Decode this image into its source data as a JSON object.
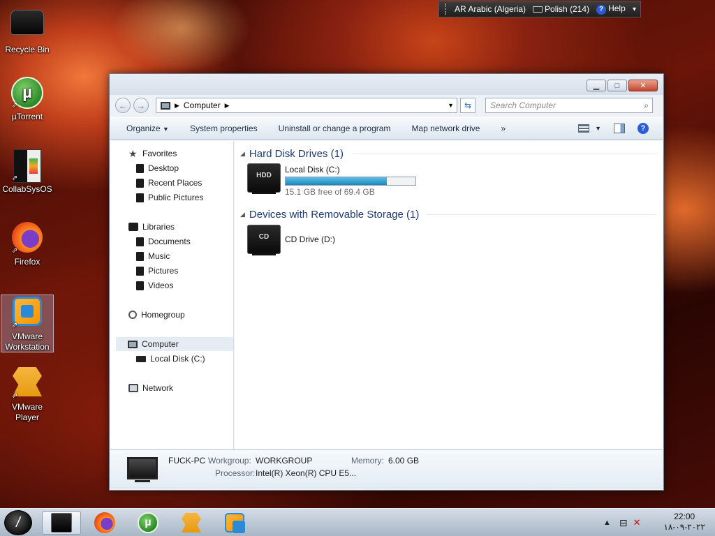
{
  "language_bar": {
    "language": "AR Arabic (Algeria)",
    "layout": "Polish (214)",
    "help": "Help"
  },
  "desktop": {
    "icons": [
      {
        "label": "Recycle Bin",
        "icon": "recycle-bin-icon"
      },
      {
        "label": "µTorrent",
        "icon": "utorrent-icon"
      },
      {
        "label": "CollabSysOS",
        "icon": "collabsysos-icon"
      },
      {
        "label": "Firefox",
        "icon": "firefox-icon"
      },
      {
        "label": "VMware Workstation",
        "icon": "vmware-workstation-icon"
      },
      {
        "label": "VMware Player",
        "icon": "vmware-player-icon"
      }
    ]
  },
  "window": {
    "address": {
      "crumb": "Computer"
    },
    "search": {
      "placeholder": "Search Computer"
    },
    "toolbar": {
      "organize": "Organize",
      "system_properties": "System properties",
      "uninstall": "Uninstall or change a program",
      "map_drive": "Map network drive",
      "more": "»"
    },
    "nav": {
      "favorites": "Favorites",
      "desktop": "Desktop",
      "recent_places": "Recent Places",
      "public_pictures": "Public Pictures",
      "libraries": "Libraries",
      "documents": "Documents",
      "music": "Music",
      "pictures": "Pictures",
      "videos": "Videos",
      "homegroup": "Homegroup",
      "computer": "Computer",
      "local_disk": "Local Disk (C:)",
      "network": "Network"
    },
    "groups": {
      "hard_disks": {
        "title": "Hard Disk Drives (1)",
        "drives": [
          {
            "name": "Local Disk (C:)",
            "badge": "HDD",
            "free_text": "15.1 GB free of 69.4 GB",
            "used_fraction": 0.78
          }
        ]
      },
      "removable": {
        "title": "Devices with Removable Storage (1)",
        "drives": [
          {
            "name": "CD Drive (D:)",
            "badge": "CD"
          }
        ]
      }
    },
    "details": {
      "computer_name": "FUCK-PC",
      "workgroup_label": "Workgroup:",
      "workgroup": "WORKGROUP",
      "memory_label": "Memory:",
      "memory": "6.00 GB",
      "processor_label": "Processor:",
      "processor": "Intel(R) Xeon(R) CPU E5..."
    }
  },
  "taskbar": {
    "start": "/",
    "apps": [
      "file-explorer-icon",
      "firefox-icon",
      "utorrent-icon",
      "vmware-player-icon",
      "vmware-workstation-icon"
    ],
    "clock": {
      "time": "22:00",
      "date": "٢٠٢٢-٠٩-١٨"
    }
  }
}
